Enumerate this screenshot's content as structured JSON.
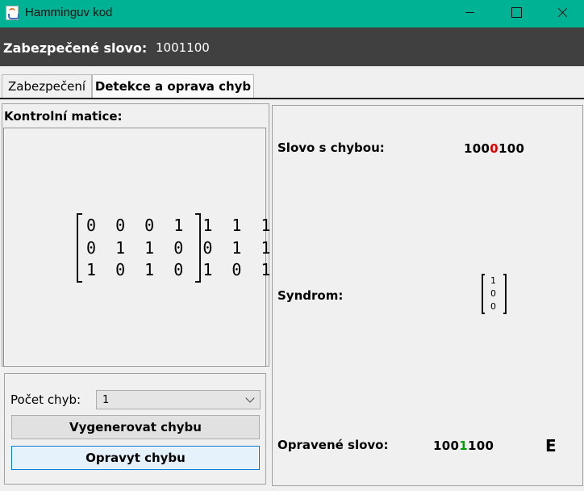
{
  "window": {
    "title": "Hamminguv kod",
    "icon": "java-cup-icon"
  },
  "header": {
    "label": "Zabezpečené slovo:",
    "value": "1001100"
  },
  "tabs": [
    {
      "label": "Zabezpečení",
      "selected": false
    },
    {
      "label": "Detekce a oprava chyb",
      "selected": true
    }
  ],
  "left": {
    "title": "Kontrolní matice:",
    "matrix": [
      "0 0 0 1 1 1 1",
      "0 1 1 0 0 1 1",
      "1 0 1 0 1 0 1"
    ],
    "error_count_label": "Počet chyb:",
    "error_count_value": "1",
    "generate_button": "Vygenerovat chybu",
    "fix_button": "Opravyt chybu"
  },
  "right": {
    "error_word_label": "Slovo s chybou:",
    "error_word": {
      "before": "100",
      "highlight": "0",
      "after": "100"
    },
    "syndrome_label": "Syndrom:",
    "syndrome": [
      "1",
      "0",
      "0"
    ],
    "fixed_word_label": "Opravené slovo:",
    "fixed_word": {
      "before": "100",
      "highlight": "1",
      "after": "100"
    },
    "marker": "E"
  },
  "colors": {
    "titlebar": "#00b294",
    "header": "#404040",
    "error": "#e00000",
    "fixed": "#00a000"
  }
}
